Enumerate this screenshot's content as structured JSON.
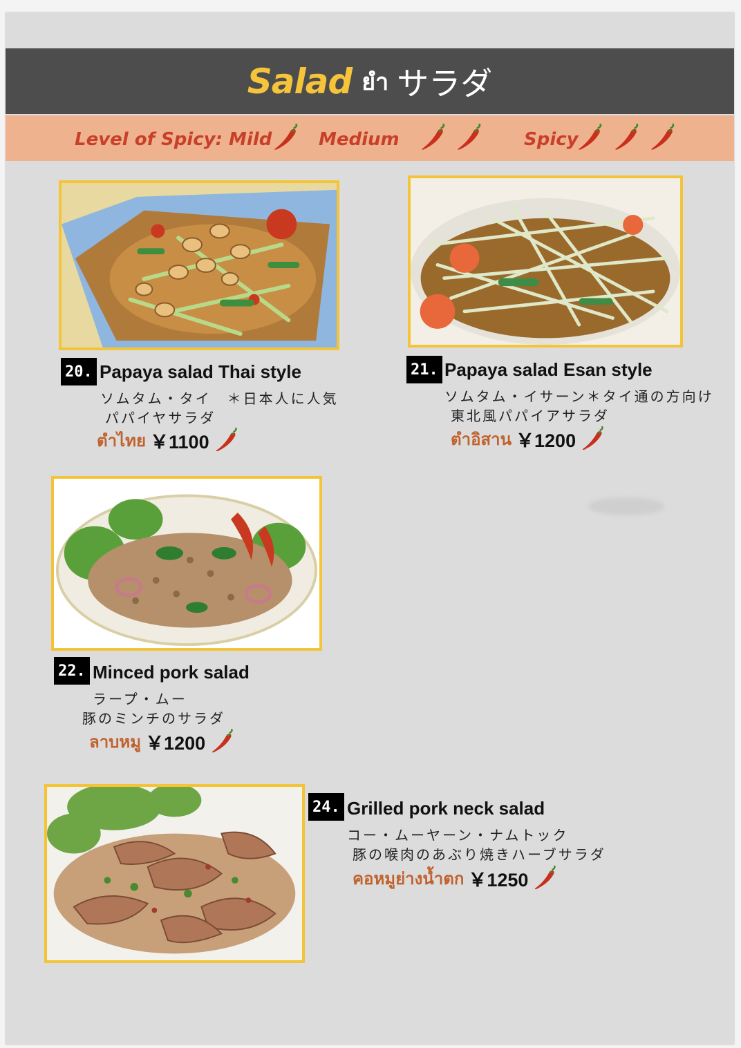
{
  "header": {
    "title_en": "Salad",
    "title_th": "ยำ",
    "title_jp": "サラダ"
  },
  "spicy_legend": {
    "label": "Level of Spicy: Mild",
    "medium": "Medium",
    "spicy": "Spicy",
    "chili_color": "#c8301c"
  },
  "dishes": [
    {
      "number": "20.",
      "name": "Papaya salad Thai style",
      "jp_line1": "ソムタム・タイ　＊日本人に人気",
      "jp_line2": "パパイヤサラダ",
      "thai_name": "ตำไทย",
      "price": "￥1100",
      "photo_icon": "papaya-salad-thai-photo"
    },
    {
      "number": "21.",
      "name": "Papaya salad Esan style",
      "jp_line1": "ソムタム・イサーン＊タイ通の方向け",
      "jp_line2": "東北風パパイアサラダ",
      "thai_name": "ตำอิสาน",
      "price": "￥1200",
      "photo_icon": "papaya-salad-esan-photo"
    },
    {
      "number": "22.",
      "name": "Minced pork salad",
      "jp_line1": "ラープ・ムー",
      "jp_line2": "豚のミンチのサラダ",
      "thai_name": "ลาบหมู",
      "price": "￥1200",
      "photo_icon": "minced-pork-salad-photo"
    },
    {
      "number": "24.",
      "name": "Grilled pork neck salad",
      "jp_line1": "コー・ムーヤーン・ナムトック",
      "jp_line2": "豚の喉肉のあぶり焼きハーブサラダ",
      "thai_name": "คอหมูย่างน้ำตก",
      "price": "￥1250",
      "photo_icon": "grilled-pork-neck-salad-photo"
    }
  ],
  "colors": {
    "title_bar": "#4d4d4d",
    "title_accent": "#f5c43a",
    "spicy_bar": "#efb28f",
    "thai_text": "#c0622d",
    "photo_border": "#f3c437"
  }
}
